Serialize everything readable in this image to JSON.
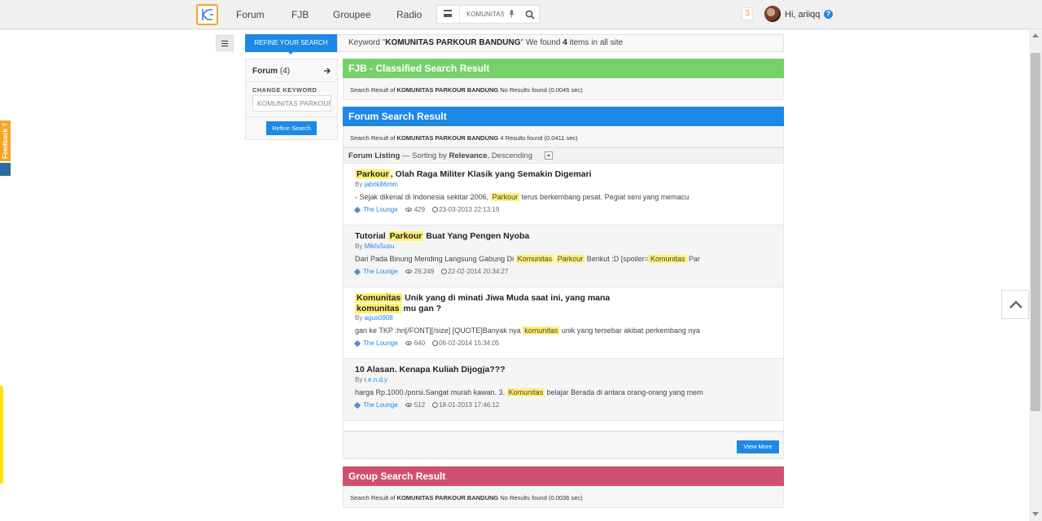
{
  "nav": {
    "items": [
      "Forum",
      "FJB",
      "Groupee",
      "Radio"
    ],
    "search_value": "KOMUNITAS PARKOUR BANDUNG",
    "notification_count": "3",
    "greeting": "Hi, ariiqq",
    "help": "?"
  },
  "feedback": {
    "label": "Feedback ?"
  },
  "refine": {
    "header_button": "REFINE YOUR SEARCH",
    "keyword_prefix": "Keyword \"",
    "keyword": "KOMUNITAS PARKOUR BANDUNG",
    "keyword_middle": "\" We found ",
    "count": "4",
    "keyword_suffix": " items in all site"
  },
  "sidebar": {
    "forum_label": "Forum",
    "forum_count": "(4)",
    "change_keyword": "CHANGE KEYWORD",
    "keyword_value": "KOMUNITAS PARKOUR BANDUNG",
    "refine_button": "Refine Search"
  },
  "fjb": {
    "title": "FJB - Classified Search Result",
    "info_prefix": "Search Result of ",
    "keyword": "KOMUNITAS PARKOUR BANDUNG",
    "info_suffix": " No Results found (0.0046 sec)",
    "color": "#77d16b"
  },
  "forum": {
    "title": "Forum Search Result",
    "info_prefix": "Search Result of ",
    "keyword": "KOMUNITAS PARKOUR BANDUNG",
    "info_suffix": " 4 Results found (0.0411 sec)",
    "color": "#1e88e5",
    "listing_label": "Forum Listing",
    "sorting_prefix": " — Sorting by ",
    "sorting_field": "Relevance",
    "sorting_order": ", Descending",
    "view_more": "View More",
    "results": [
      {
        "title_hl1": "Parkour",
        "title_rest": ", Olah Raga Militer Klasik yang Semakin Digemari",
        "by": "By ",
        "author": "jabrik86mm",
        "snippet_a": "- Sejak dikenal di Indonesia sekitar 2006, ",
        "snippet_hl1": "Parkour",
        "snippet_b": " terus berkembang pesat. Pegiat seni yang memacu",
        "category": "The Lounge",
        "views": "429",
        "date": "23-03-2013 22:13:19"
      },
      {
        "title_pre": "Tutorial ",
        "title_hl1": "Parkour",
        "title_rest": " Buat Yang Pengen Nyoba",
        "by": "By ",
        "author": "MikIsSusu",
        "snippet_a": "Dari Pada Binung Mending Langsung Gabung Di ",
        "snippet_hl1": "Komunitas",
        "snippet_hl2": "Parkour",
        "snippet_b": " Berikut :D [spoiler=",
        "snippet_hl3": "Komunitas",
        "snippet_c": " Par",
        "category": "The Lounge",
        "views": "29,249",
        "date": "22-02-2014 20:34:27"
      },
      {
        "title_hl1": "Komunitas",
        "title_mid": " Unik yang di minati Jiwa Muda saat ini, yang mana ",
        "title_hl2": "komunitas",
        "title_rest": " mu gan ?",
        "by": "By ",
        "author": "agus0908",
        "snippet_a": "gan ke TKP :hn[/FONT][/size] [QUOTE]Banyak nya ",
        "snippet_hl1": "komunitas",
        "snippet_b": " unik yang tersebar akibat perkembang nya",
        "category": "The Lounge",
        "views": "640",
        "date": "06-02-2014 15:34:05"
      },
      {
        "title": "10 Alasan. Kenapa Kuliah Dijogja???",
        "by": "By ",
        "author": "r.e.n.d.y",
        "snippet_a": "harga Rp.1000./porsi.Sangat murah kawan. 3. ",
        "snippet_hl1": "Komunitas",
        "snippet_b": " belajar Berada di antara orang-orang yang mem",
        "category": "The Lounge",
        "views": "512",
        "date": "18-01-2013 17:46:12"
      }
    ]
  },
  "group": {
    "title": "Group Search Result",
    "info_prefix": "Search Result of ",
    "keyword": "KOMUNITAS PARKOUR BANDUNG",
    "info_suffix": " No Results found (0.0036 sec)",
    "color": "#d1506f"
  }
}
